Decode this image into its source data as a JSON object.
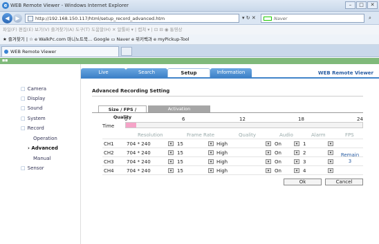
{
  "window": {
    "title": "WEB Remote Viewer - Windows Internet Explorer",
    "controls": [
      "–",
      "□",
      "✕"
    ]
  },
  "address_bar": {
    "url": "http://192.168.150.117/html/setup_record_advanced.htm",
    "search_placeholder": "Naver"
  },
  "menu": "파일(F)  편집(E)  보기(V)  즐겨찾기(A)  도구(T)  도움말(H)     ✕  알툴바 ▾  | 캡쳐 ▾  |  ⊡ ⊟  ◉ 통영상",
  "favorites": "★ 즐겨찾기  |  ☆ e WalkPc.com 마니노트북...  Google  ▭ Naver  e 위키백과  e myPickup-Tool",
  "browser_tab": "WEB Remote Viewer",
  "nav": {
    "tabs": [
      "Live",
      "Search",
      "Setup",
      "Information"
    ],
    "active": "Setup",
    "brand": "WEB Remote Viewer"
  },
  "sidebar": {
    "items": [
      "Camera",
      "Display",
      "Sound",
      "System",
      "Record"
    ],
    "record_sub": [
      "Operation",
      "Advanced",
      "Manual"
    ],
    "selected": "Advanced",
    "sensor": "Sensor"
  },
  "page": {
    "heading": "Advanced Recording Setting",
    "subtabs": [
      "Size / FPS / Quality",
      "Activation"
    ],
    "time_label": "Time",
    "ticks": [
      "0",
      "6",
      "12",
      "18",
      "24"
    ],
    "time_fill_fraction": 0.043
  },
  "table": {
    "headers": [
      "Resolution",
      "Frame Rate",
      "Quality",
      "Audio",
      "Alarm",
      "FPS"
    ],
    "rows": [
      {
        "ch": "CH1",
        "resolution": "704 * 240",
        "frame": "15",
        "quality": "High",
        "audio": "On",
        "alarm": "1"
      },
      {
        "ch": "CH2",
        "resolution": "704 * 240",
        "frame": "15",
        "quality": "High",
        "audio": "On",
        "alarm": "2"
      },
      {
        "ch": "CH3",
        "resolution": "704 * 240",
        "frame": "15",
        "quality": "High",
        "audio": "On",
        "alarm": "3"
      },
      {
        "ch": "CH4",
        "resolution": "704 * 240",
        "frame": "15",
        "quality": "High",
        "audio": "On",
        "alarm": "4"
      }
    ],
    "remain_label": "Remain",
    "remain_value": "3"
  },
  "buttons": {
    "ok": "Ok",
    "cancel": "Cancel"
  },
  "dropdown_glyph": "▾"
}
